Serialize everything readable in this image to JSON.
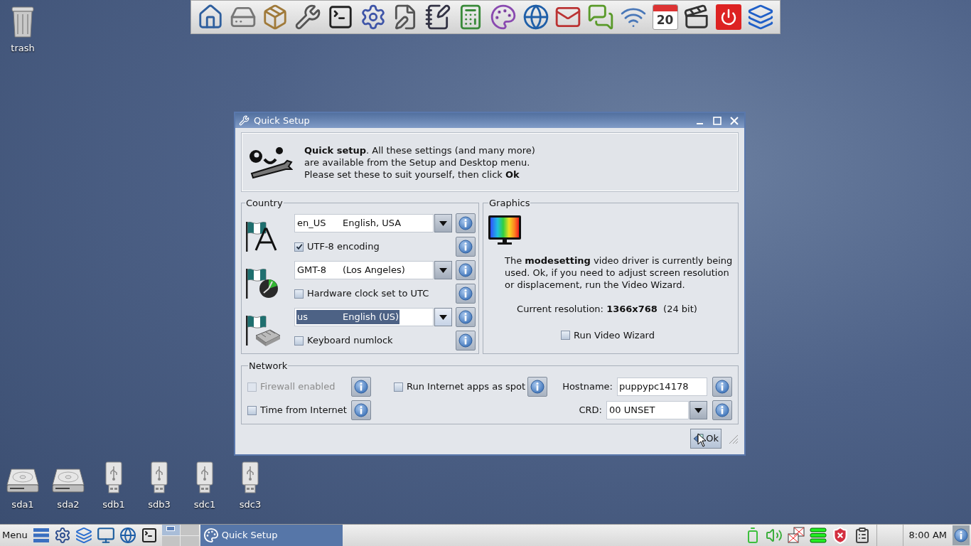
{
  "desktop": {
    "top_icons": [
      {
        "label": "trash",
        "kind": "trash"
      }
    ],
    "drive_icons": [
      {
        "label": "sda1",
        "kind": "disk"
      },
      {
        "label": "sda2",
        "kind": "disk"
      },
      {
        "label": "sdb1",
        "kind": "usb"
      },
      {
        "label": "sdb3",
        "kind": "usb"
      },
      {
        "label": "sdc1",
        "kind": "usb"
      },
      {
        "label": "sdc3",
        "kind": "usb"
      }
    ]
  },
  "dock": {
    "calendar_day": "20"
  },
  "window": {
    "title": "Quick Setup",
    "intro": [
      "**Quick setup**. All these settings (and many more)",
      "are available from the Setup and Desktop menu.",
      "Please set these to suit yourself, then click **Ok**"
    ],
    "country": {
      "title": "Country",
      "groups": [
        {
          "kind": "locale",
          "dropdown": {
            "code": "en_US",
            "name": "English, USA",
            "text_selected": false,
            "focused": false
          },
          "checkbox": {
            "label": "UTF-8 encoding",
            "checked": true
          }
        },
        {
          "kind": "timezone",
          "dropdown": {
            "code": "GMT-8",
            "name": "(Los Angeles)",
            "text_selected": false,
            "focused": false
          },
          "checkbox": {
            "label": "Hardware clock set to UTC",
            "checked": false
          }
        },
        {
          "kind": "keyboard",
          "dropdown": {
            "code": "us",
            "name": "English (US)",
            "text_selected": true,
            "focused": true
          },
          "checkbox": {
            "label": "Keyboard numlock",
            "checked": false
          }
        }
      ]
    },
    "graphics": {
      "title": "Graphics",
      "description": "The **modesetting** video driver is currently being used. Ok, if you need to adjust screen resolution or displacement, run the Video Wizard.",
      "resolution": "Current resolution: **1366x768**  (24 bit)",
      "wizard": {
        "label": "Run Video Wizard",
        "checked": false
      }
    },
    "network": {
      "title": "Network",
      "firewall": {
        "label": "Firewall enabled",
        "checked": false,
        "disabled": true
      },
      "spot": {
        "label": "Run Internet apps as spot",
        "checked": false,
        "disabled": false
      },
      "time": {
        "label": "Time from Internet",
        "checked": false,
        "disabled": false
      },
      "hostname": {
        "label": "Hostname:",
        "value": "puppypc14178"
      },
      "crd": {
        "label": "CRD:",
        "value": "00 UNSET"
      }
    },
    "ok_button": "Ok"
  },
  "taskbar": {
    "menu": "Menu",
    "tasks": [
      {
        "label": "Quick Setup",
        "selected": true
      }
    ],
    "clock": "8:00 AM"
  }
}
